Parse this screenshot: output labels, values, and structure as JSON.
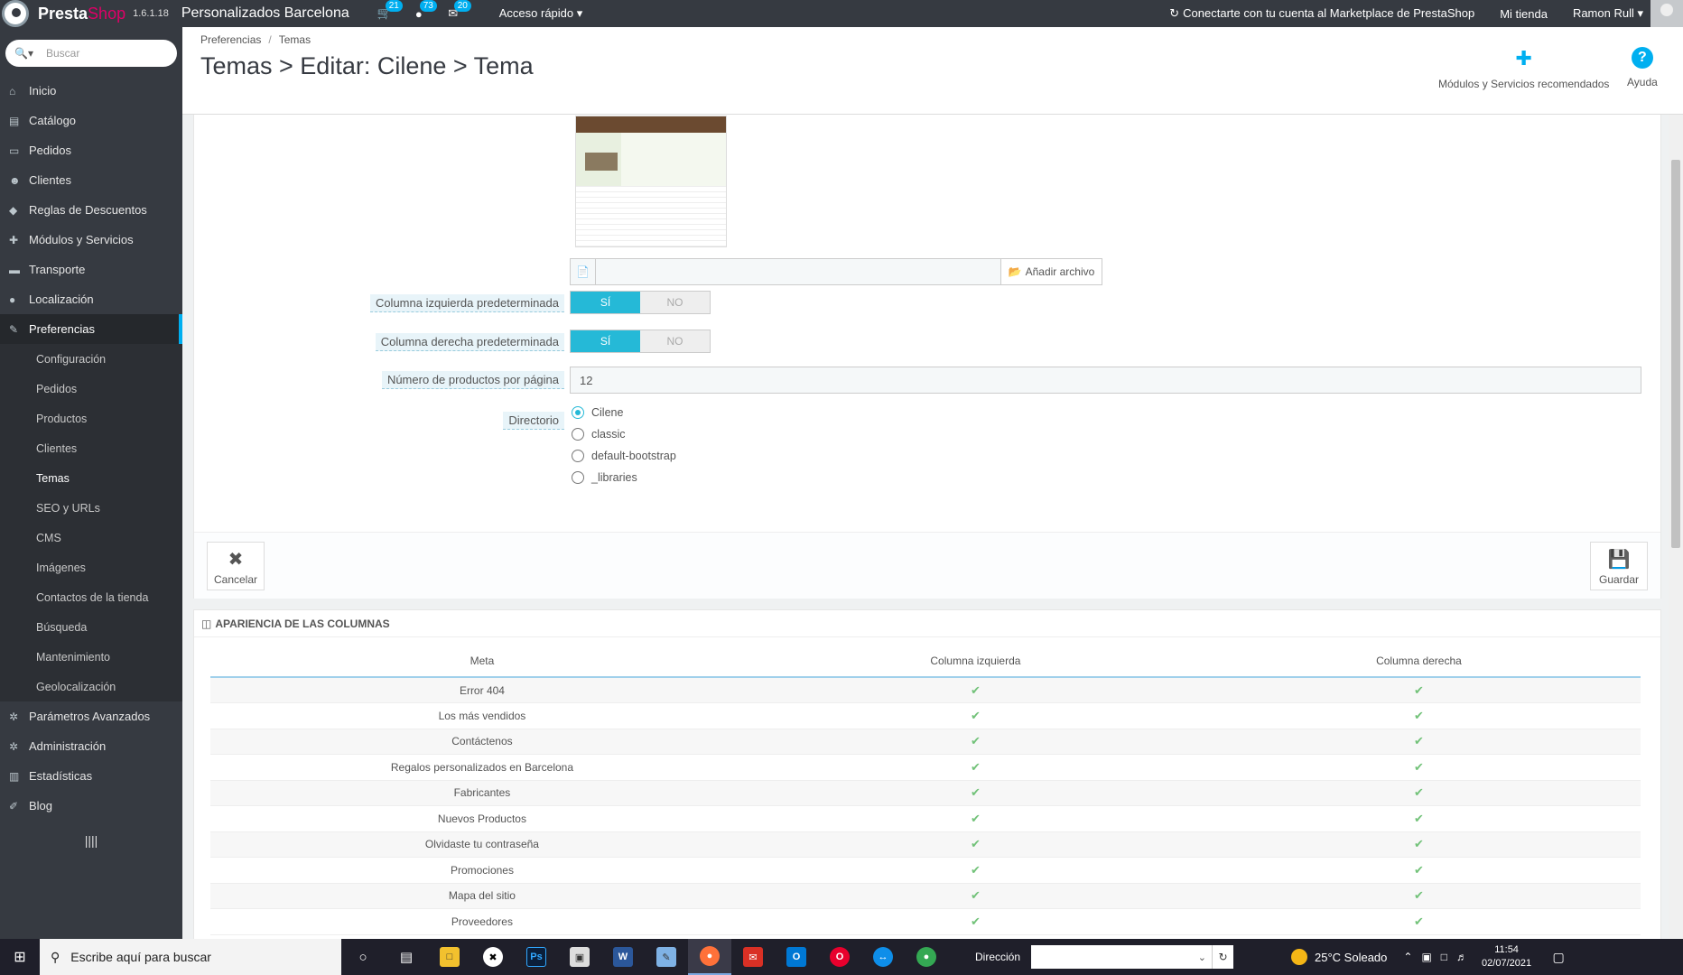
{
  "topbar": {
    "brand_part1": "Presta",
    "brand_part2": "Shop",
    "version": "1.6.1.18",
    "shop_name": "Personalizados Barcelona",
    "orders_count": "21",
    "customers_count": "73",
    "messages_count": "20",
    "quick_access": "Acceso rápido ▾",
    "marketplace": "Conectarte con tu cuenta al Marketplace de PrestaShop",
    "my_store": "Mi tienda",
    "user": "Ramon Rull ▾"
  },
  "sidebar": {
    "search_placeholder": "Buscar",
    "items": [
      {
        "label": "Inicio",
        "icon": "home-icon"
      },
      {
        "label": "Catálogo",
        "icon": "book-icon"
      },
      {
        "label": "Pedidos",
        "icon": "credit-card-icon"
      },
      {
        "label": "Clientes",
        "icon": "users-icon"
      },
      {
        "label": "Reglas de Descuentos",
        "icon": "tag-icon"
      },
      {
        "label": "Módulos y Servicios",
        "icon": "puzzle-icon"
      },
      {
        "label": "Transporte",
        "icon": "truck-icon"
      },
      {
        "label": "Localización",
        "icon": "globe-icon"
      },
      {
        "label": "Preferencias",
        "icon": "wrench-icon"
      }
    ],
    "sub_items": [
      "Configuración",
      "Pedidos",
      "Productos",
      "Clientes",
      "Temas",
      "SEO y URLs",
      "CMS",
      "Imágenes",
      "Contactos de la tienda",
      "Búsqueda",
      "Mantenimiento",
      "Geolocalización"
    ],
    "bottom_items": [
      {
        "label": "Parámetros Avanzados",
        "icon": "cogs-icon"
      },
      {
        "label": "Administración",
        "icon": "cog-icon"
      },
      {
        "label": "Estadísticas",
        "icon": "bar-chart-icon"
      },
      {
        "label": "Blog",
        "icon": "edit-icon"
      }
    ],
    "collapse": "||||"
  },
  "header": {
    "breadcrumb": [
      "Preferencias",
      "Temas"
    ],
    "title": "Temas > Editar: Cilene > Tema",
    "modules_label": "Módulos y Servicios recomendados",
    "help_label": "Ayuda"
  },
  "form": {
    "add_file": "Añadir archivo",
    "left_column_label": "Columna izquierda predeterminada",
    "right_column_label": "Columna derecha predeterminada",
    "yes": "SÍ",
    "no": "NO",
    "products_per_page_label": "Número de productos por página",
    "products_per_page_value": "12",
    "directory_label": "Directorio",
    "directories": [
      "Cilene",
      "classic",
      "default-bootstrap",
      "_libraries"
    ],
    "selected_directory": "Cilene",
    "cancel": "Cancelar",
    "save": "Guardar"
  },
  "columns_panel": {
    "heading": "APARIENCIA DE LAS COLUMNAS",
    "headers": [
      "Meta",
      "Columna izquierda",
      "Columna derecha"
    ],
    "rows": [
      "Error 404",
      "Los más vendidos",
      "Contáctenos",
      "Regalos personalizados en Barcelona",
      "Fabricantes",
      "Nuevos Productos",
      "Olvidaste tu contraseña",
      "Promociones",
      "Mapa del sitio",
      "Proveedores"
    ],
    "check_color": "#72c279"
  },
  "taskbar": {
    "search_placeholder": "Escribe aquí para buscar",
    "address_label": "Dirección",
    "weather": "25°C  Soleado",
    "time": "11:54",
    "date": "02/07/2021"
  },
  "colors": {
    "accent": "#25b9d7",
    "sidebar_bg": "#363a41",
    "brand_pink": "#df0067"
  }
}
